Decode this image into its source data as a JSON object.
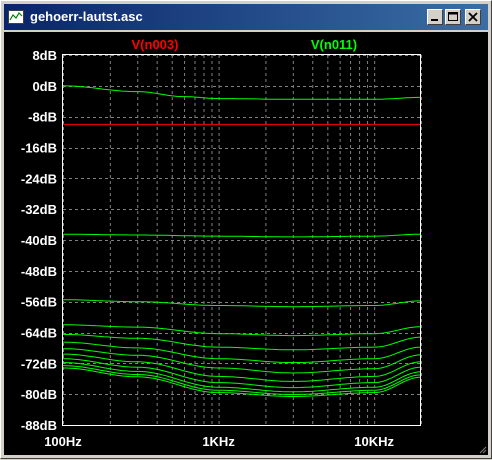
{
  "window": {
    "title": "gehoerr-lautst.asc",
    "buttons": {
      "minimize": "minimize-icon",
      "maximize": "maximize-icon",
      "close": "close-icon"
    }
  },
  "colors": {
    "title_start": "#0a246a",
    "title_end": "#3a6ea5",
    "plot_bg": "#000000",
    "grid": "#808080",
    "axis_text": "#ffffff",
    "trace_v003": "#ff0000",
    "trace_v011": "#00ff00"
  },
  "chart_data": {
    "type": "line",
    "title": "",
    "xlabel": "",
    "ylabel": "",
    "x_scale": "log",
    "xlim": [
      100,
      20000
    ],
    "ylim": [
      -88,
      8
    ],
    "grid": true,
    "x_tick_labels": [
      "100Hz",
      "1KHz",
      "10KHz"
    ],
    "y_tick_labels": [
      "8dB",
      "0dB",
      "-8dB",
      "-16dB",
      "-24dB",
      "-32dB",
      "-40dB",
      "-48dB",
      "-56dB",
      "-64dB",
      "-72dB",
      "-80dB",
      "-88dB"
    ],
    "legend": [
      "V(n003)",
      "V(n011)"
    ],
    "series": [
      {
        "name": "V(n003)",
        "color": "#ff0000",
        "x": [
          100,
          20000
        ],
        "y": [
          -10,
          -10
        ]
      },
      {
        "name": "V(n011)",
        "color": "#00ff00",
        "x": [
          100,
          300,
          600,
          1000,
          3000,
          10000,
          20000
        ],
        "y": [
          0,
          -1.5,
          -2.8,
          -3.3,
          -3.5,
          -3.5,
          -3.0
        ]
      },
      {
        "name": "V(n011)",
        "color": "#00ff00",
        "x": [
          100,
          300,
          1000,
          3000,
          10000,
          20000
        ],
        "y": [
          -38.5,
          -38.7,
          -39.0,
          -39.2,
          -39.0,
          -38.5
        ]
      },
      {
        "name": "V(n011)",
        "color": "#00ff00",
        "x": [
          100,
          300,
          1000,
          3000,
          10000,
          20000
        ],
        "y": [
          -55.5,
          -56.0,
          -57.0,
          -57.3,
          -57.0,
          -55.8
        ]
      },
      {
        "name": "V(n011)",
        "color": "#00ff00",
        "x": [
          100,
          300,
          1000,
          3000,
          10000,
          20000
        ],
        "y": [
          -62.0,
          -62.6,
          -64.3,
          -64.8,
          -64.3,
          -62.5
        ]
      },
      {
        "name": "V(n011)",
        "color": "#00ff00",
        "x": [
          100,
          300,
          1000,
          3000,
          10000,
          20000
        ],
        "y": [
          -64.5,
          -65.5,
          -67.8,
          -68.5,
          -67.8,
          -65.2
        ]
      },
      {
        "name": "V(n011)",
        "color": "#00ff00",
        "x": [
          100,
          300,
          1000,
          3000,
          10000,
          20000
        ],
        "y": [
          -66.5,
          -68.0,
          -70.8,
          -71.8,
          -70.8,
          -67.8
        ]
      },
      {
        "name": "V(n011)",
        "color": "#00ff00",
        "x": [
          100,
          300,
          1000,
          3000,
          10000,
          20000
        ],
        "y": [
          -68.2,
          -69.9,
          -73.2,
          -74.5,
          -73.4,
          -69.8
        ]
      },
      {
        "name": "V(n011)",
        "color": "#00ff00",
        "x": [
          100,
          300,
          1000,
          3000,
          10000,
          20000
        ],
        "y": [
          -69.6,
          -71.6,
          -75.4,
          -76.7,
          -75.4,
          -71.6
        ]
      },
      {
        "name": "V(n011)",
        "color": "#00ff00",
        "x": [
          100,
          300,
          1000,
          3000,
          10000,
          20000
        ],
        "y": [
          -70.8,
          -73.0,
          -77.0,
          -78.3,
          -77.0,
          -73.0
        ]
      },
      {
        "name": "V(n011)",
        "color": "#00ff00",
        "x": [
          100,
          300,
          1000,
          3000,
          10000,
          20000
        ],
        "y": [
          -71.8,
          -74.1,
          -78.2,
          -79.4,
          -78.2,
          -74.2
        ]
      },
      {
        "name": "V(n011)",
        "color": "#00ff00",
        "x": [
          100,
          300,
          1000,
          3000,
          10000,
          20000
        ],
        "y": [
          -72.6,
          -74.9,
          -79.0,
          -80.1,
          -79.0,
          -75.0
        ]
      },
      {
        "name": "V(n011)",
        "color": "#00ff00",
        "x": [
          100,
          300,
          1000,
          3000,
          10000,
          20000
        ],
        "y": [
          -73.2,
          -75.5,
          -79.6,
          -80.6,
          -79.6,
          -75.6
        ]
      }
    ]
  }
}
